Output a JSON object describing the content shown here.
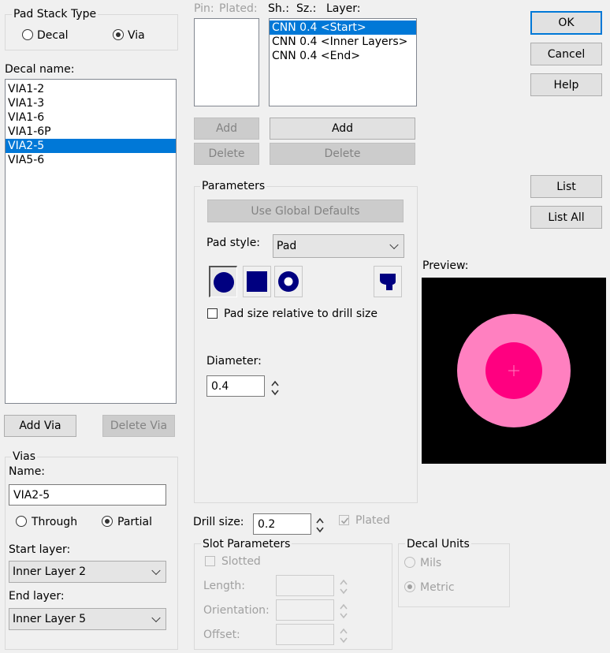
{
  "pad_stack_type": {
    "title": "Pad Stack Type",
    "options": [
      {
        "label": "Decal",
        "checked": false
      },
      {
        "label": "Via",
        "checked": true
      }
    ]
  },
  "decal_list": {
    "label": "Decal name:",
    "items": [
      "VIA1-2",
      "VIA1-3",
      "VIA1-6",
      "VIA1-6P",
      "VIA2-5",
      "VIA5-6"
    ],
    "selected_index": 4,
    "add_label": "Add Via",
    "delete_label": "Delete Via"
  },
  "vias": {
    "title": "Vias",
    "name_label": "Name:",
    "name_value": "VIA2-5",
    "through_label": "Through",
    "partial_label": "Partial",
    "type_selected": "Partial",
    "start_layer_label": "Start layer:",
    "start_layer_value": "Inner Layer 2",
    "end_layer_label": "End layer:",
    "end_layer_value": "Inner Layer 5"
  },
  "pin_header": {
    "pin": "Pin:",
    "plated": "Plated:",
    "shape": "Sh.:",
    "size": "Sz.:",
    "layer": "Layer:"
  },
  "shape_list": {
    "items": [
      "CNN 0.4 <Start>",
      "CNN 0.4 <Inner Layers>",
      "CNN 0.4 <End>"
    ],
    "selected_index": 0
  },
  "pin_buttons": {
    "add": "Add",
    "delete": "Delete"
  },
  "shape_buttons": {
    "add": "Add",
    "delete": "Delete"
  },
  "parameters": {
    "title": "Parameters",
    "use_global_defaults": "Use Global Defaults",
    "pad_style_label": "Pad style:",
    "pad_style_value": "Pad",
    "pad_shapes": [
      "round-pad-icon",
      "square-pad-icon",
      "annular-pad-icon",
      "custom-pad-icon"
    ],
    "relative_label": "Pad size relative to drill size",
    "relative_checked": false,
    "diameter_label": "Diameter:",
    "diameter_value": "0.4"
  },
  "drill": {
    "label": "Drill size:",
    "value": "0.2",
    "plated_label": "Plated",
    "plated_checked": true
  },
  "slot": {
    "title": "Slot Parameters",
    "slotted_label": "Slotted",
    "length_label": "Length:",
    "orientation_label": "Orientation:",
    "offset_label": "Offset:"
  },
  "decal_units": {
    "title": "Decal Units",
    "mils": "Mils",
    "metric": "Metric",
    "selected": "Metric"
  },
  "dialog_buttons": {
    "ok": "OK",
    "cancel": "Cancel",
    "help": "Help",
    "list": "List",
    "list_all": "List All"
  },
  "preview": {
    "label": "Preview:",
    "background": "#000000",
    "pad_color": "#ff80c0",
    "drill_color": "#ff0080"
  },
  "colors": {
    "selection": "#0078d7",
    "pad_icon": "#000080",
    "default_button_border": "#0078d7"
  }
}
